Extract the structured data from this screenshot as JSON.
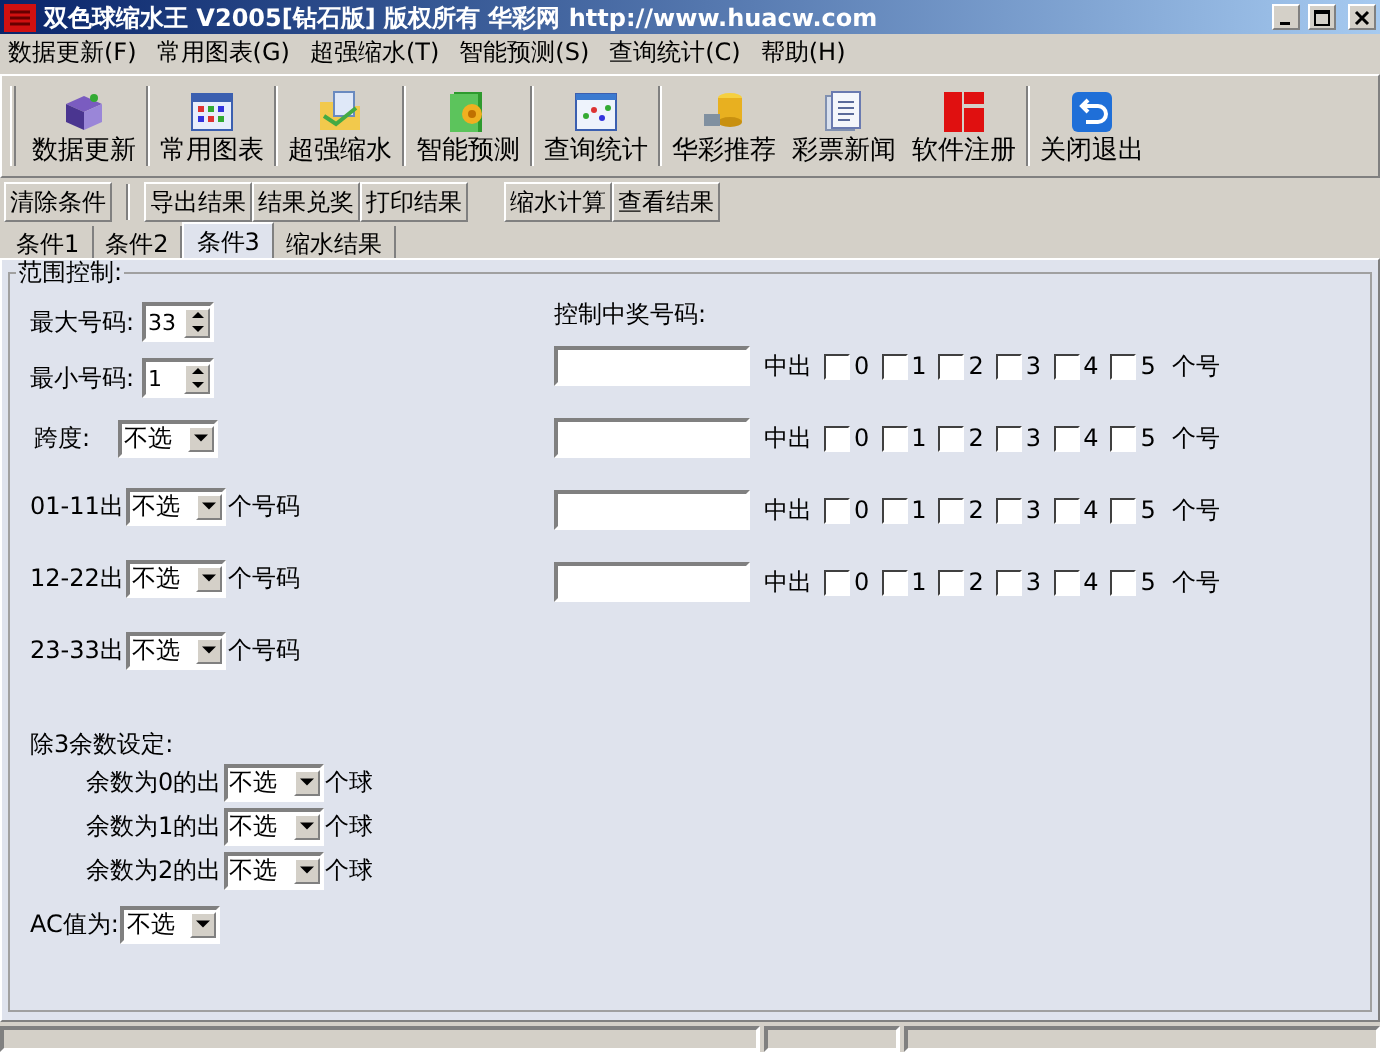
{
  "window": {
    "title": "双色球缩水王 V2005[钻石版] 版权所有 华彩网 http://www.huacw.com"
  },
  "menu": [
    "数据更新(F)",
    "常用图表(G)",
    "超强缩水(T)",
    "智能预测(S)",
    "查询统计(C)",
    "帮助(H)"
  ],
  "toolbar": [
    "数据更新",
    "常用图表",
    "超强缩水",
    "智能预测",
    "查询统计",
    "华彩推荐",
    "彩票新闻",
    "软件注册",
    "关闭退出"
  ],
  "action_groups": [
    [
      "清除条件"
    ],
    [
      "导出结果",
      "结果兑奖",
      "打印结果"
    ],
    [
      "缩水计算",
      "查看结果"
    ]
  ],
  "tabs": [
    {
      "label": "条件1",
      "selected": false
    },
    {
      "label": "条件2",
      "selected": false
    },
    {
      "label": "条件3",
      "selected": true
    },
    {
      "label": "缩水结果",
      "selected": false
    }
  ],
  "range_group": {
    "title": "范围控制:",
    "spinners": [
      {
        "label": "最大号码:",
        "value": "33"
      },
      {
        "label": "最小号码:",
        "value": "1"
      }
    ],
    "span": {
      "label": "跨度:",
      "value": "不选"
    },
    "zones": [
      {
        "label": "01-11出",
        "value": "不选",
        "unit": "个号码"
      },
      {
        "label": "12-22出",
        "value": "不选",
        "unit": "个号码"
      },
      {
        "label": "23-33出",
        "value": "不选",
        "unit": "个号码"
      }
    ],
    "mod3": {
      "title": "除3余数设定:",
      "rows": [
        {
          "label": "余数为0的出",
          "value": "不选",
          "unit": "个球"
        },
        {
          "label": "余数为1的出",
          "value": "不选",
          "unit": "个球"
        },
        {
          "label": "余数为2的出",
          "value": "不选",
          "unit": "个球"
        }
      ]
    },
    "ac": {
      "label": "AC值为:",
      "value": "不选"
    },
    "prize_control": {
      "title": "控制中奖号码:",
      "rows": [
        {
          "label": "中出",
          "options": [
            {
              "label": "0",
              "checked": false
            },
            {
              "label": "1",
              "checked": false
            },
            {
              "label": "2",
              "checked": false
            },
            {
              "label": "3",
              "checked": false
            },
            {
              "label": "4",
              "checked": false
            },
            {
              "label": "5",
              "checked": false
            }
          ],
          "unit": "个号"
        },
        {
          "label": "中出",
          "options": [
            {
              "label": "0",
              "checked": false
            },
            {
              "label": "1",
              "checked": false
            },
            {
              "label": "2",
              "checked": false
            },
            {
              "label": "3",
              "checked": false
            },
            {
              "label": "4",
              "checked": false
            },
            {
              "label": "5",
              "checked": false
            }
          ],
          "unit": "个号"
        },
        {
          "label": "中出",
          "options": [
            {
              "label": "0",
              "checked": false
            },
            {
              "label": "1",
              "checked": false
            },
            {
              "label": "2",
              "checked": false
            },
            {
              "label": "3",
              "checked": false
            },
            {
              "label": "4",
              "checked": false
            },
            {
              "label": "5",
              "checked": false
            }
          ],
          "unit": "个号"
        },
        {
          "label": "中出",
          "options": [
            {
              "label": "0",
              "checked": false
            },
            {
              "label": "1",
              "checked": false
            },
            {
              "label": "2",
              "checked": false
            },
            {
              "label": "3",
              "checked": false
            },
            {
              "label": "4",
              "checked": false
            },
            {
              "label": "5",
              "checked": false
            }
          ],
          "unit": "个号"
        }
      ]
    }
  }
}
